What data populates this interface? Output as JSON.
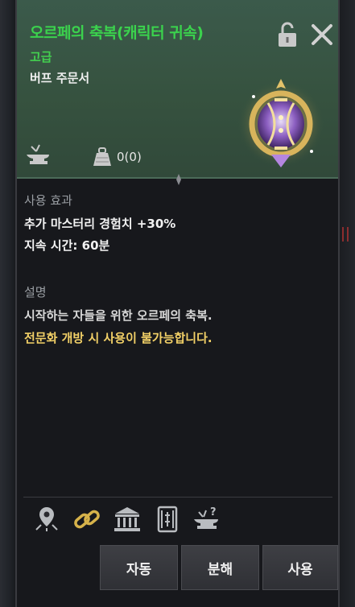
{
  "item": {
    "title": "오르페의 축복(캐릭터 귀속)",
    "grade": "고급",
    "type": "버프 주문서",
    "weight": "0(0)"
  },
  "effect": {
    "label": "사용 효과",
    "line1": "추가 마스터리 경험치 +30%",
    "line2": "지속 시간: 60분"
  },
  "description": {
    "label": "설명",
    "line1": "시작하는 자들을 위한 오르페의 축복.",
    "warning": "전문화 개방 시 사용이 불가능합니다."
  },
  "toolbar_icons": [
    "map-pin-icon",
    "chain-link-icon",
    "bank-icon",
    "scroll-icon",
    "anvil-question-icon"
  ],
  "buttons": {
    "auto": "자동",
    "disassemble": "분해",
    "use": "사용"
  },
  "colors": {
    "title_green": "#3bd24d",
    "warning_yellow": "#f2d067",
    "header_bg": "#36523f"
  }
}
